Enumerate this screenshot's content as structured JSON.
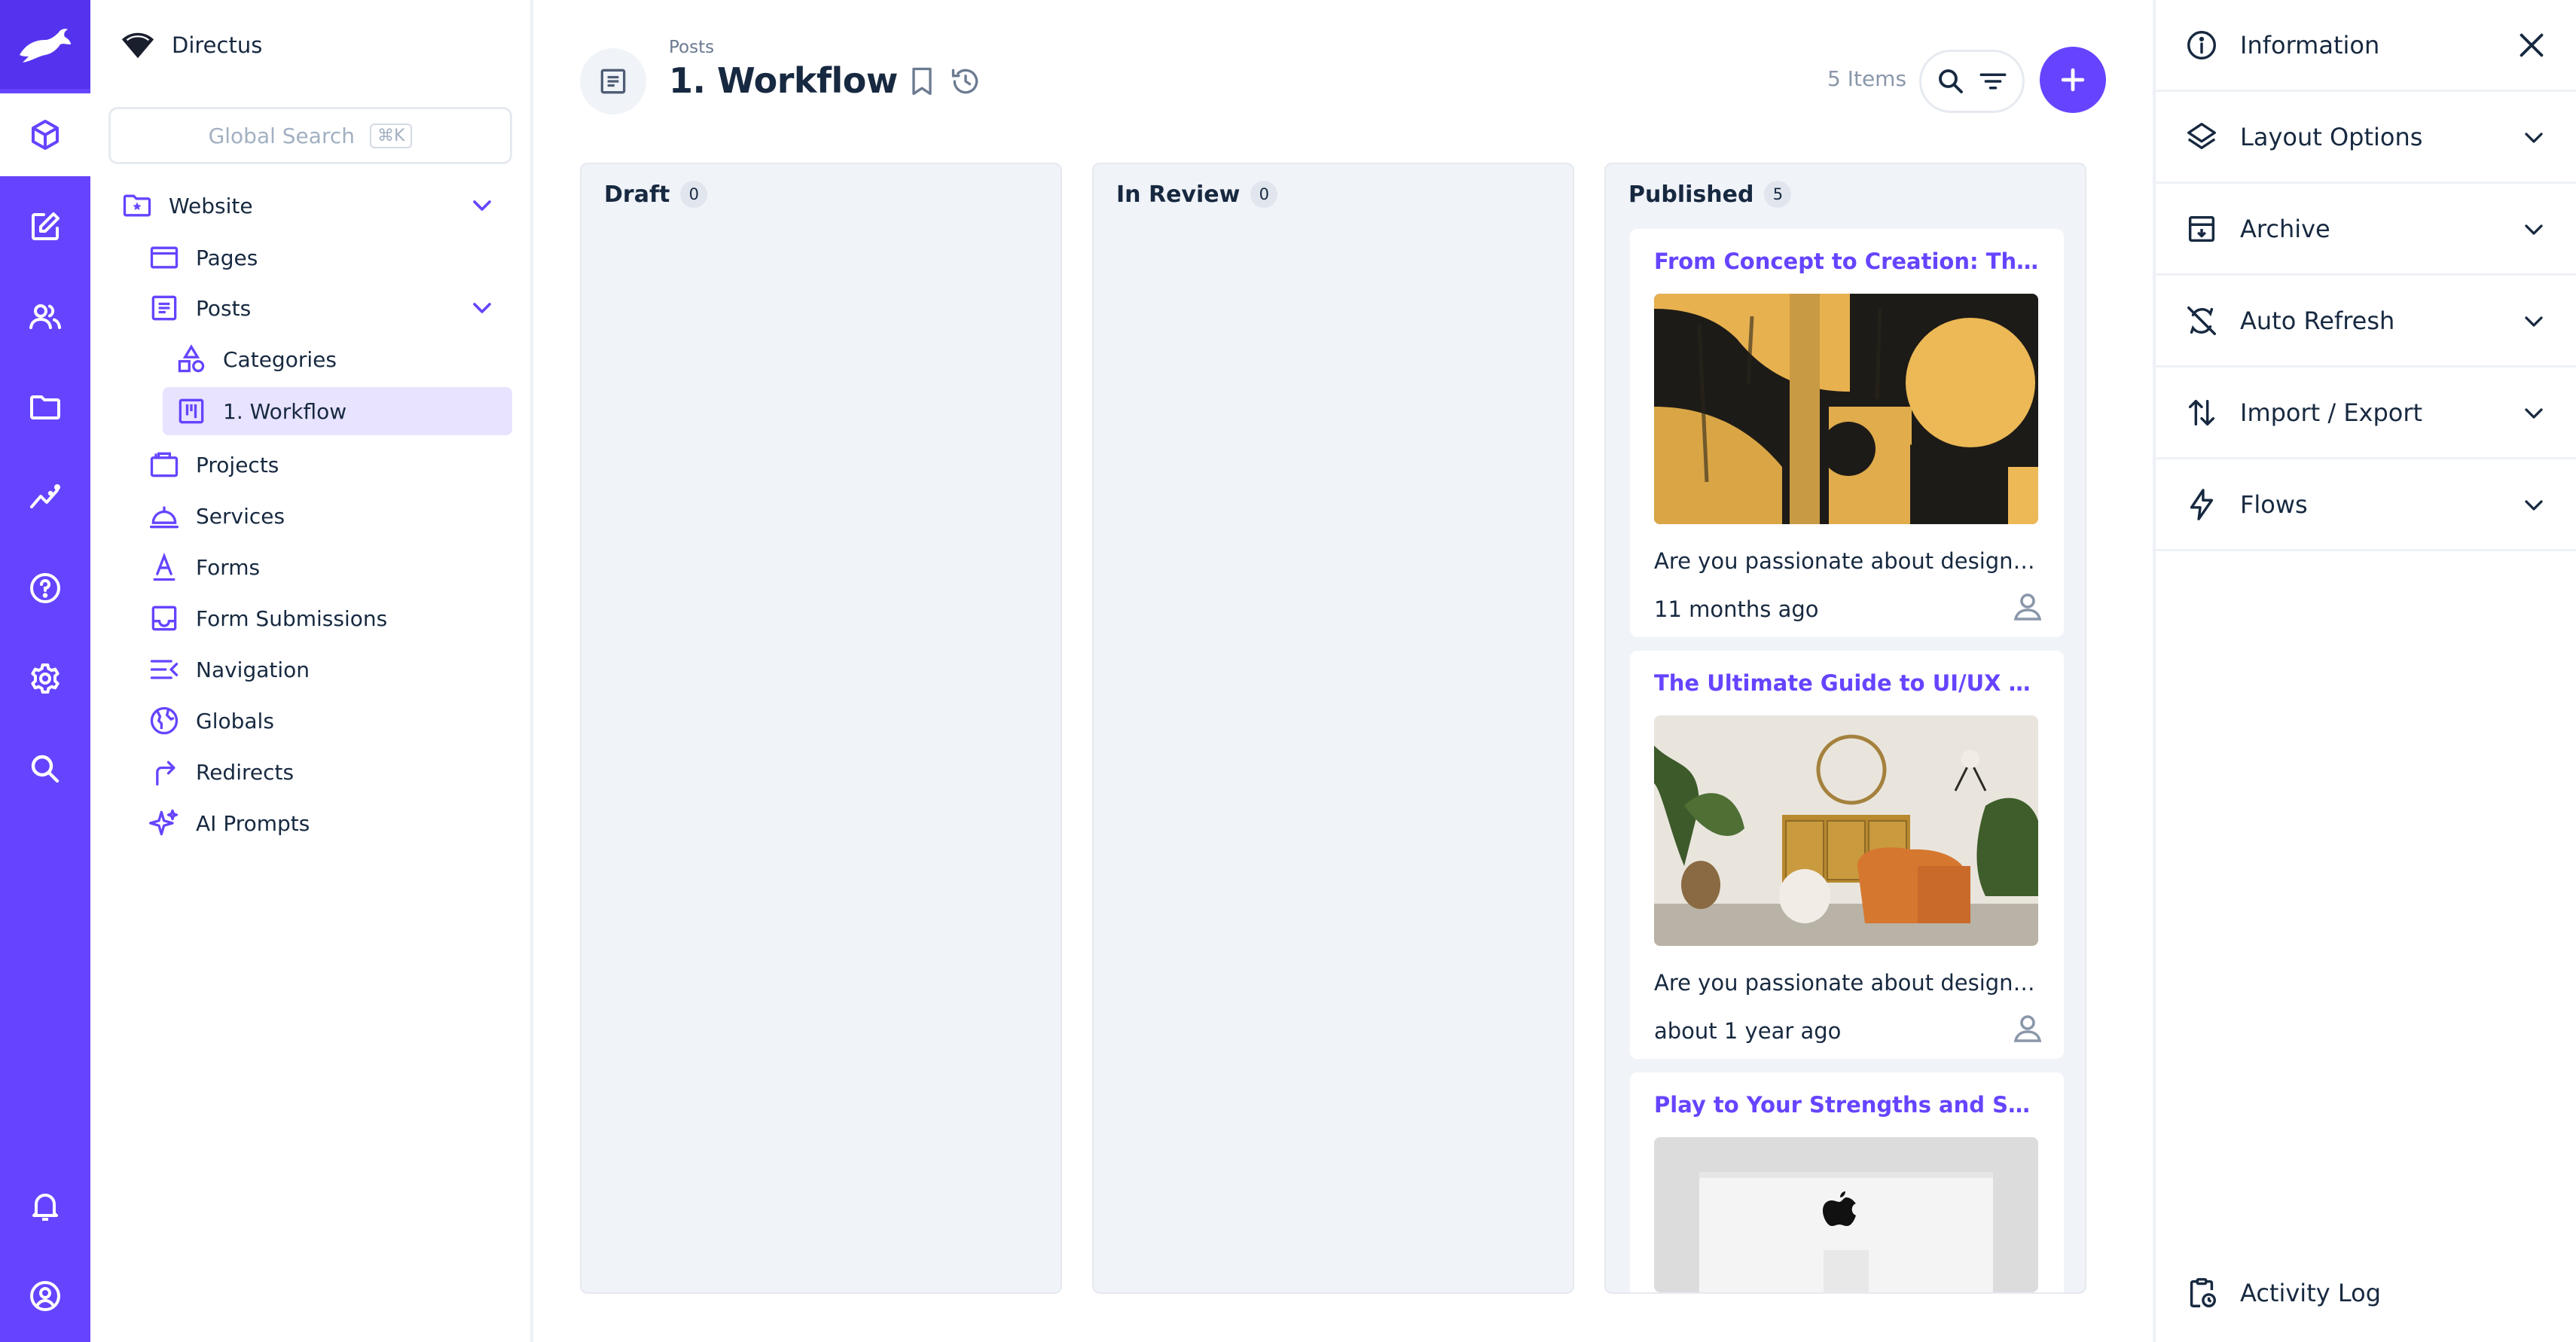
{
  "app": {
    "project_name": "Directus",
    "accent_color": "#6644ff"
  },
  "module_bar": {
    "modules": [
      {
        "name": "content",
        "icon": "cube-icon",
        "active": true
      },
      {
        "name": "visual-editor",
        "icon": "edit-icon"
      },
      {
        "name": "users",
        "icon": "users-icon"
      },
      {
        "name": "files",
        "icon": "folder-icon"
      },
      {
        "name": "insights",
        "icon": "insights-icon"
      },
      {
        "name": "help",
        "icon": "help-icon"
      },
      {
        "name": "settings",
        "icon": "gear-icon"
      },
      {
        "name": "search",
        "icon": "search-icon"
      }
    ],
    "bottom": [
      {
        "name": "notifications",
        "icon": "bell-icon"
      },
      {
        "name": "user",
        "icon": "account-icon"
      }
    ]
  },
  "nav": {
    "search_placeholder": "Global Search",
    "search_shortcut": "⌘K",
    "items": [
      {
        "label": "Website",
        "icon": "folder-star-icon",
        "expanded": true
      },
      {
        "label": "Pages",
        "icon": "page-icon"
      },
      {
        "label": "Posts",
        "icon": "article-icon",
        "expanded": true
      },
      {
        "label": "Categories",
        "icon": "category-icon"
      },
      {
        "label": "1. Workflow",
        "icon": "kanban-icon",
        "active": true
      },
      {
        "label": "Projects",
        "icon": "briefcase-icon"
      },
      {
        "label": "Services",
        "icon": "room-service-icon"
      },
      {
        "label": "Forms",
        "icon": "forms-icon"
      },
      {
        "label": "Form Submissions",
        "icon": "inbox-icon"
      },
      {
        "label": "Navigation",
        "icon": "menu-open-icon"
      },
      {
        "label": "Globals",
        "icon": "globe-icon"
      },
      {
        "label": "Redirects",
        "icon": "redirect-icon"
      },
      {
        "label": "AI Prompts",
        "icon": "sparkles-icon"
      }
    ]
  },
  "header": {
    "breadcrumb": "Posts",
    "title": "1. Workflow",
    "item_count": "5 Items"
  },
  "board": {
    "columns": [
      {
        "title": "Draft",
        "count": "0"
      },
      {
        "title": "In Review",
        "count": "0"
      },
      {
        "title": "Published",
        "count": "5"
      }
    ],
    "cards": [
      {
        "title": "From Concept to Creation: The De...",
        "description": "Are you passionate about design a...",
        "date": "11 months ago",
        "image": "abstract-painting"
      },
      {
        "title": "The Ultimate Guide to UI/UX Desig...",
        "description": "Are you passionate about design a...",
        "date": "about 1 year ago",
        "image": "living-room"
      },
      {
        "title": "Play to Your Strengths and Superc...",
        "image": "imac"
      }
    ]
  },
  "sidebar": {
    "sections": [
      {
        "label": "Information",
        "icon": "info-icon"
      },
      {
        "label": "Layout Options",
        "icon": "layers-icon"
      },
      {
        "label": "Archive",
        "icon": "archive-icon"
      },
      {
        "label": "Auto Refresh",
        "icon": "sync-disabled-icon"
      },
      {
        "label": "Import / Export",
        "icon": "import-export-icon"
      },
      {
        "label": "Flows",
        "icon": "bolt-icon"
      }
    ],
    "activity_log": "Activity Log"
  }
}
